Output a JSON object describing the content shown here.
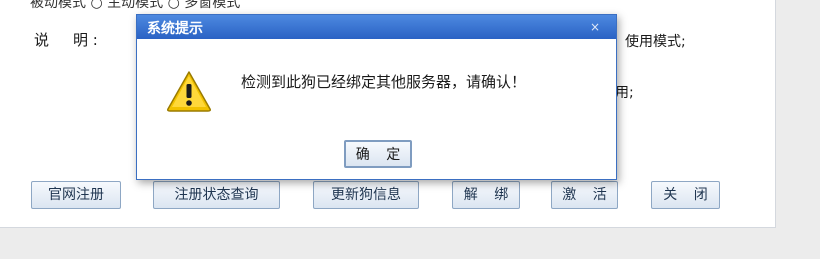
{
  "window": {
    "top_line": "被动模式  ○ 主动模式 ○ 多窗模式",
    "description_label_1": "说",
    "description_label_2": "明 :",
    "side_text_1": "使用模式;",
    "side_text_2": "用;"
  },
  "buttons": {
    "official_register": "官网注册",
    "status_query": "注册状态查询",
    "update_dongle": "更新狗信息",
    "unbind": "解 绑",
    "activate": "激 活",
    "close": "关 闭"
  },
  "dialog": {
    "title": "系统提示",
    "close_glyph": "×",
    "message": "检测到此狗已经绑定其他服务器，请确认！",
    "ok_label": "确 定"
  },
  "colors": {
    "titlebar": "#2a62c4",
    "warning_icon": "#f2c200"
  },
  "icons": {
    "dialog_icon": "warning-icon"
  }
}
